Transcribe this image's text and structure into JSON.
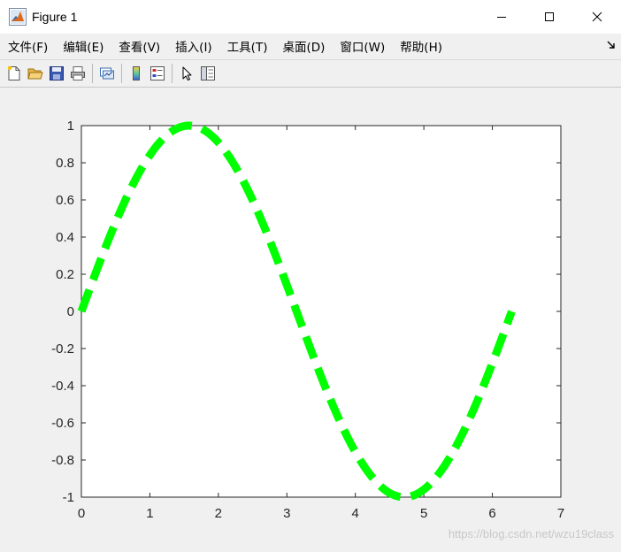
{
  "window": {
    "title": "Figure 1"
  },
  "menu": {
    "items": [
      "文件(F)",
      "编辑(E)",
      "查看(V)",
      "插入(I)",
      "工具(T)",
      "桌面(D)",
      "窗口(W)",
      "帮助(H)"
    ]
  },
  "toolbar": {
    "buttons": [
      "new-figure-icon",
      "open-file-icon",
      "save-icon",
      "print-icon",
      "link-plot-icon",
      "colorbar-icon",
      "legend-icon",
      "edit-plot-icon",
      "property-inspector-icon"
    ]
  },
  "colors": {
    "line": "#00ff00",
    "axes_bg": "#ffffff",
    "figure_bg": "#f0f0f0"
  },
  "chart_data": {
    "type": "line",
    "function": "sin(x)",
    "x_range": [
      0,
      6.283
    ],
    "xlim": [
      0,
      7
    ],
    "ylim": [
      -1,
      1
    ],
    "xticks": [
      "0",
      "1",
      "2",
      "3",
      "4",
      "5",
      "6",
      "7"
    ],
    "yticks": [
      "1",
      "0.8",
      "0.6",
      "0.4",
      "0.2",
      "0",
      "-0.2",
      "-0.4",
      "-0.6",
      "-0.8",
      "-1"
    ],
    "series": [
      {
        "line_style": "dashed",
        "color": "#00ff00"
      }
    ],
    "grid": false
  },
  "watermark": "https://blog.csdn.net/wzu19class"
}
